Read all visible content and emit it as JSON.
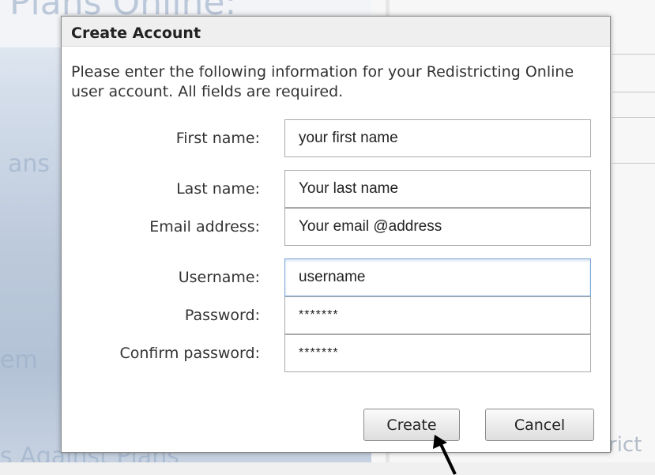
{
  "dialog": {
    "title": "Create Account",
    "intro": "Please enter the following information for your Redistricting Online user account.  All fields are required.",
    "fields": [
      {
        "label": "First name:",
        "value": "your first name"
      },
      {
        "label": "Last name:",
        "value": "Your last name"
      },
      {
        "label": "Email address:",
        "value": "Your email @address"
      },
      {
        "label": "Username:",
        "value": "username"
      },
      {
        "label": "Password:",
        "value": "*******"
      },
      {
        "label": "Confirm password:",
        "value": "*******"
      }
    ],
    "create_label": "Create",
    "cancel_label": "Cancel"
  },
  "background": {
    "heading_fragment": "Plans Online:",
    "fragments": [
      "ans",
      "em",
      "s Against Plans",
      "rict"
    ]
  },
  "icons": {
    "pointer": "arrow-pointer-icon"
  }
}
